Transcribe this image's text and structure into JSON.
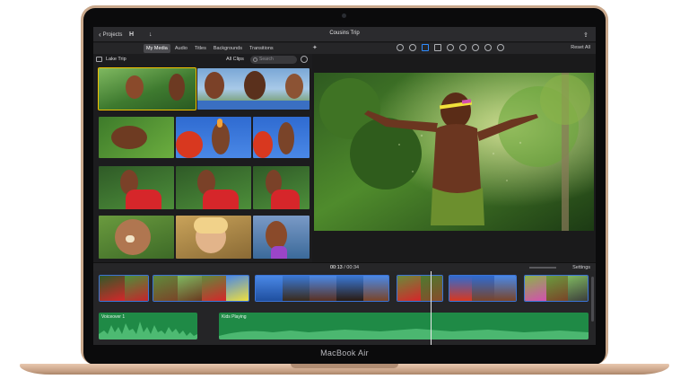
{
  "device": {
    "label": "MacBook Air"
  },
  "app": {
    "project_title": "Cousins Trip",
    "projects_button": "Projects",
    "tabs": [
      {
        "label": "My Media",
        "active": true
      },
      {
        "label": "Audio",
        "active": false
      },
      {
        "label": "Titles",
        "active": false
      },
      {
        "label": "Backgrounds",
        "active": false
      },
      {
        "label": "Transitions",
        "active": false
      }
    ],
    "reset_all": "Reset All"
  },
  "browser": {
    "event_name": "Lake Trip",
    "filter": "All Clips",
    "search_placeholder": "Search"
  },
  "timeline": {
    "current_time": "00:13",
    "separator": " / ",
    "total_time": "00:34",
    "settings_label": "Settings",
    "audio_clips": [
      {
        "label": "Voiceover 1"
      },
      {
        "label": "Kids Playing"
      }
    ]
  },
  "icons": {
    "chevron": "‹",
    "play": "▶",
    "prev": "⏮",
    "next": "⏭",
    "download": "↓",
    "share": "⇪",
    "expand": "⤢",
    "gear": "⚙"
  },
  "colors": {
    "laptop_gold": "#c9a88c",
    "selection_yellow": "#f2c200",
    "video_track_blue": "#3b74d6",
    "audio_track_green": "#1f8a46"
  }
}
